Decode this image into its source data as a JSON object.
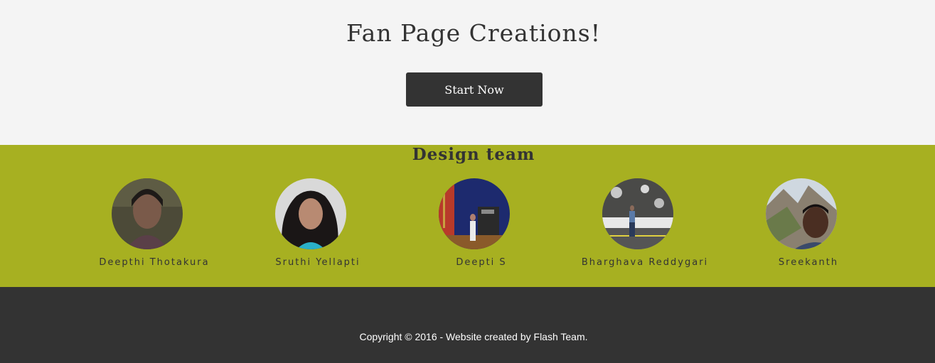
{
  "hero": {
    "title": "Fan Page Creations!",
    "start_label": "Start Now"
  },
  "team": {
    "title": "Design team",
    "members": [
      {
        "name": "Deepthi Thotakura"
      },
      {
        "name": "Sruthi Yellapti"
      },
      {
        "name": "Deepti S"
      },
      {
        "name": "Bharghava Reddygari"
      },
      {
        "name": "Sreekanth"
      }
    ]
  },
  "footer": {
    "copyright": "Copyright © 2016 - Website created by Flash Team."
  },
  "colors": {
    "hero_bg": "#f4f4f4",
    "team_bg": "#a7b021",
    "footer_bg": "#333333",
    "button_bg": "#333333",
    "text_dark": "#333333"
  }
}
